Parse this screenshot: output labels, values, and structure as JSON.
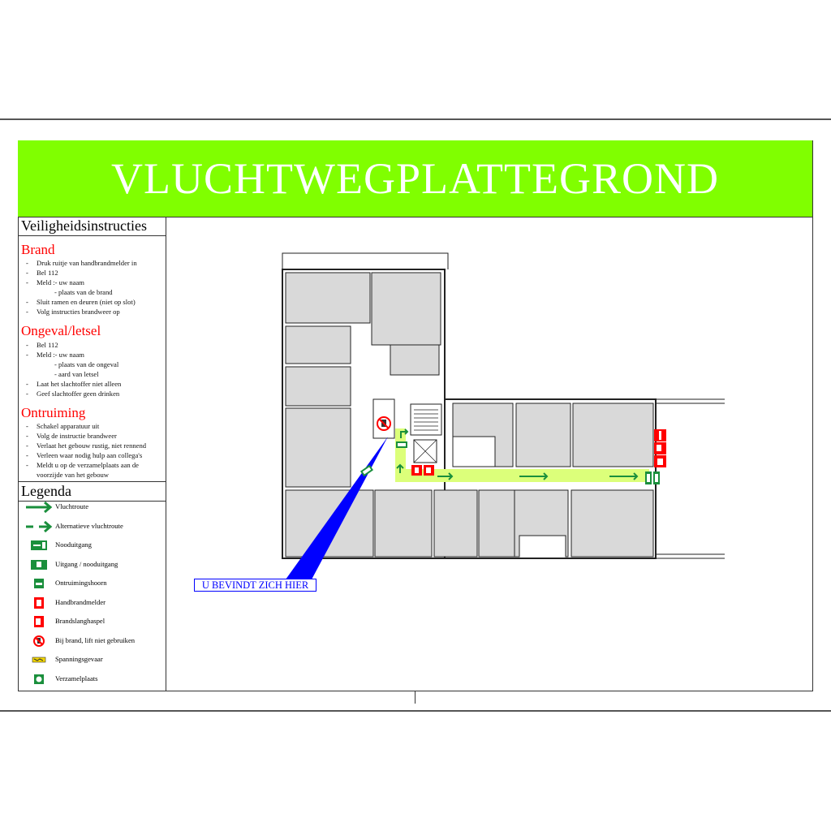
{
  "title": "VLUCHTWEGPLATTEGROND",
  "instructions": {
    "heading": "Veiligheidsinstructies",
    "brand": {
      "title": "Brand",
      "items": [
        "Druk ruitje van handbrandmelder in",
        "Bel 112",
        "Meld :- uw naam",
        "- plaats van de brand",
        "Sluit ramen en deuren (niet op slot)",
        "Volg instructies brandweer op"
      ]
    },
    "ongeval": {
      "title": "Ongeval/letsel",
      "items": [
        "Bel 112",
        "Meld :- uw naam",
        "- plaats van de ongeval",
        "- aard van letsel",
        "Laat het slachtoffer niet alleen",
        "Geef slachtoffer geen drinken"
      ]
    },
    "ontruiming": {
      "title": "Ontruiming",
      "items": [
        "Schakel apparatuur uit",
        "Volg de instructie brandweer",
        "Verlaat het gebouw rustig, niet rennend",
        "Verleen waar nodig hulp aan collega's",
        "Meldt u op de verzamelplaats aan de",
        "voorzijde van het gebouw"
      ]
    }
  },
  "legend": {
    "heading": "Legenda",
    "items": [
      {
        "icon": "escape-route-arrow",
        "label": "Vluchtroute"
      },
      {
        "icon": "alternative-route-arrow",
        "label": "Alternatieve vluchtroute"
      },
      {
        "icon": "emergency-exit-sign",
        "label": "Nooduitgang"
      },
      {
        "icon": "exit-sign",
        "label": "Uitgang / nooduitgang"
      },
      {
        "icon": "evacuation-horn",
        "label": "Ontruimingshoorn"
      },
      {
        "icon": "fire-alarm-button",
        "label": "Handbrandmelder"
      },
      {
        "icon": "fire-hose-reel",
        "label": "Brandslanghaspel"
      },
      {
        "icon": "no-lift-in-fire",
        "label": "Bij brand, lift niet gebruiken"
      },
      {
        "icon": "electrical-hazard",
        "label": "Spanningsgevaar"
      },
      {
        "icon": "assembly-point",
        "label": "Verzamelplaats"
      }
    ]
  },
  "plan": {
    "you_are_here": "U BEVINDT ZICH HIER"
  },
  "colors": {
    "banner": "#80ff00",
    "route": "#1a8f3c",
    "corridor": "#dcff7a",
    "alarm": "#ff0000",
    "pointer": "#0000ff",
    "room": "#d9d9d9"
  }
}
